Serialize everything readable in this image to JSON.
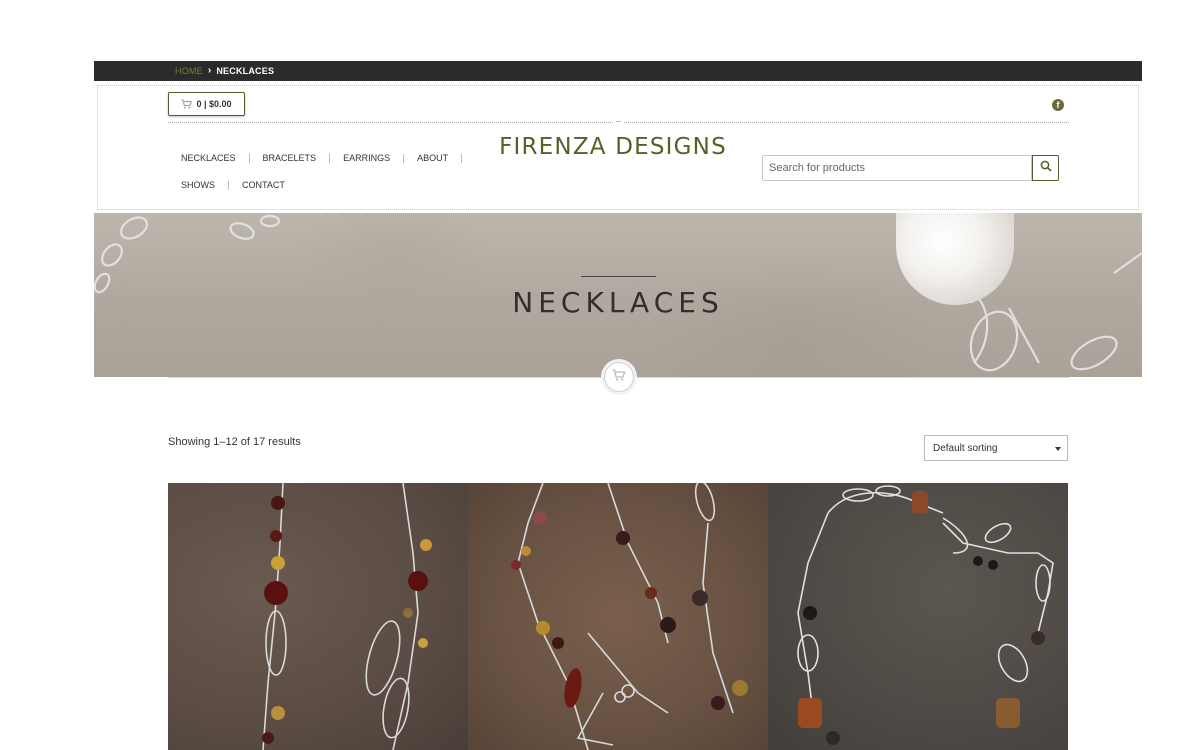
{
  "breadcrumb": {
    "home": "HOME",
    "separator": "›",
    "current": "NECKLACES"
  },
  "cart": {
    "label": "0 | $0.00",
    "icon": "cart-icon"
  },
  "social": {
    "facebook_icon": "facebook-icon",
    "facebook_glyph": "f"
  },
  "site": {
    "title": "FIRENZA DESIGNS",
    "accent_color": "#5d5d28"
  },
  "nav": {
    "row1": [
      "NECKLACES",
      "BRACELETS",
      "EARRINGS",
      "ABOUT"
    ],
    "row2": [
      "SHOWS",
      "CONTACT"
    ]
  },
  "search": {
    "placeholder": "Search for products",
    "icon": "search-icon"
  },
  "hero": {
    "title": "NECKLACES"
  },
  "shop": {
    "result_count": "Showing 1–12 of 17 results",
    "sort_selected": "Default sorting"
  },
  "products": [
    {
      "image": "necklace-photo-1"
    },
    {
      "image": "necklace-photo-2"
    },
    {
      "image": "necklace-photo-3"
    }
  ]
}
